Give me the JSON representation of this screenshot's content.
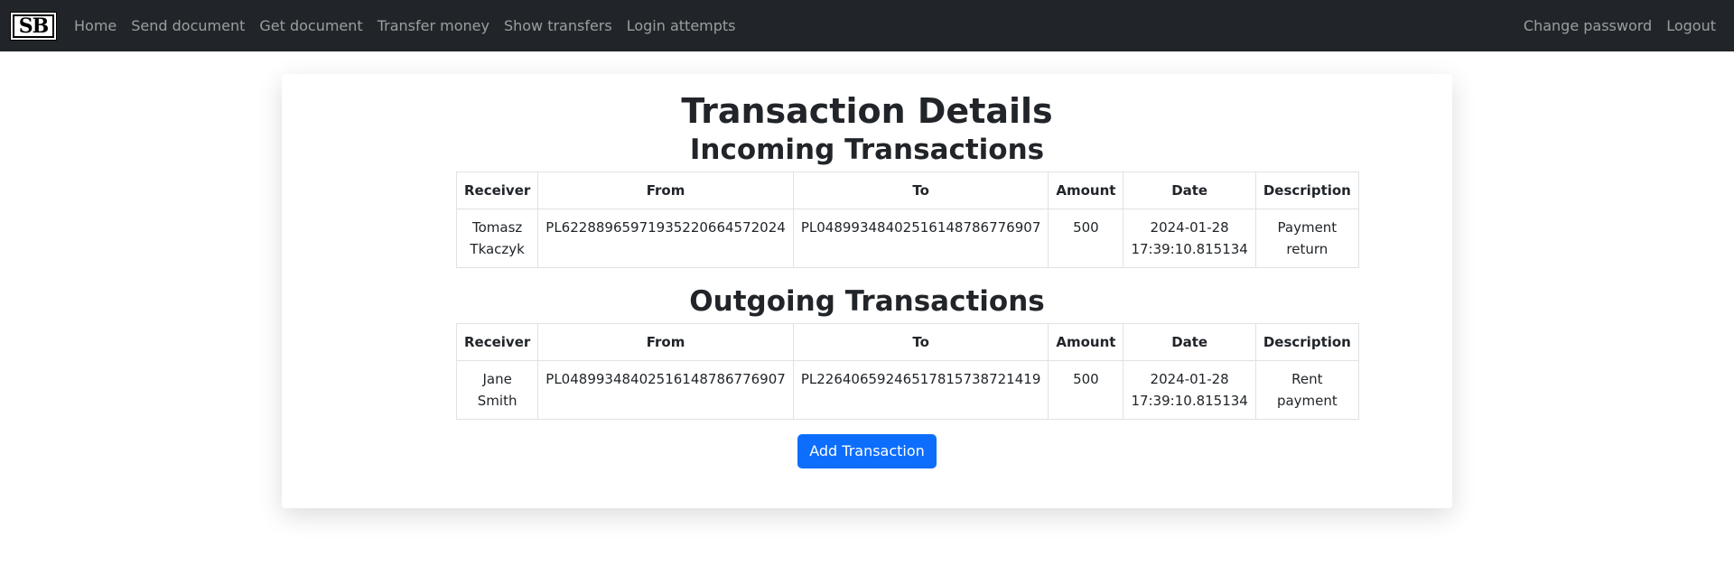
{
  "nav": {
    "brand": "SB",
    "links": [
      "Home",
      "Send document",
      "Get document",
      "Transfer money",
      "Show transfers",
      "Login attempts"
    ],
    "right_links": [
      "Change password",
      "Logout"
    ]
  },
  "page": {
    "title": "Transaction Details",
    "incoming_title": "Incoming Transactions",
    "outgoing_title": "Outgoing Transactions",
    "add_button": "Add Transaction"
  },
  "table_headers": [
    "Receiver",
    "From",
    "To",
    "Amount",
    "Date",
    "Description"
  ],
  "incoming": [
    {
      "receiver": "Tomasz Tkaczyk",
      "from": "PL62288965971935220664572024",
      "to": "PL04899348402516148786776907",
      "amount": "500",
      "date": "2024-01-28 17:39:10.815134",
      "description": "Payment return"
    }
  ],
  "outgoing": [
    {
      "receiver": "Jane Smith",
      "from": "PL04899348402516148786776907",
      "to": "PL22640659246517815738721419",
      "amount": "500",
      "date": "2024-01-28 17:39:10.815134",
      "description": "Rent payment"
    }
  ],
  "colors": {
    "navbar": "#212529",
    "primary_button": "#0d6efd"
  }
}
